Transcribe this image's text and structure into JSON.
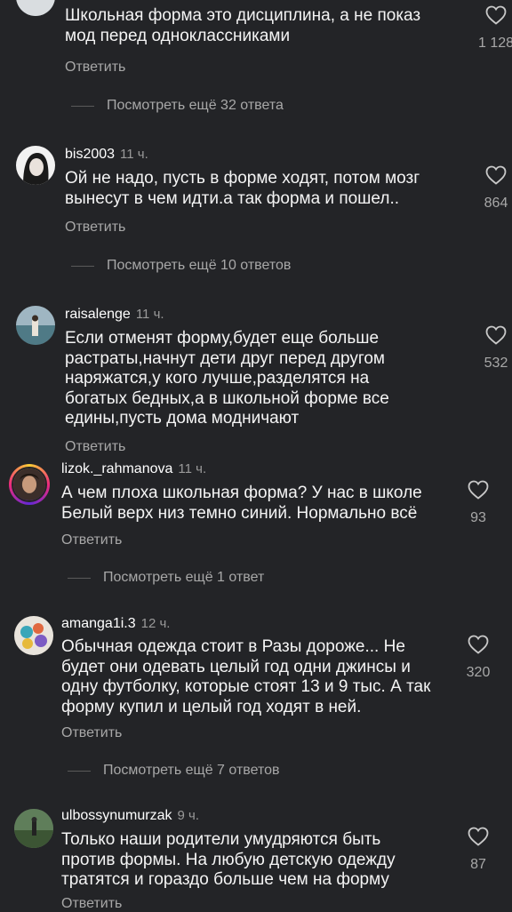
{
  "comments": [
    {
      "username": "",
      "time": "",
      "lines": [
        "Школьная форма это дисциплина, а не показ",
        "мод перед одноклассниками"
      ],
      "reply_label": "Ответить",
      "likes": "1 128",
      "view_more": "Посмотреть ещё 32 ответа"
    },
    {
      "username": "bis2003",
      "time": "11 ч.",
      "lines": [
        "Ой не надо, пусть в форме ходят, потом мозг",
        "вынесут в чем идти.а так форма и пошел.."
      ],
      "reply_label": "Ответить",
      "likes": "864",
      "view_more": "Посмотреть ещё 10 ответов"
    },
    {
      "username": "raisalenge",
      "time": "11 ч.",
      "lines": [
        "Если отменят форму,будет еще больше",
        "растраты,начнут дети друг перед другом",
        "наряжатся,у кого лучше,разделятся на",
        "богатых бедных,а в школьной форме все",
        "едины,пусть дома модничают"
      ],
      "reply_label": "Ответить",
      "likes": "532"
    },
    {
      "username": "lizok._rahmanova",
      "time": "11 ч.",
      "lines": [
        "А чем плоха школьная форма?  У нас в школе",
        "Белый верх низ темно синий. Нормально всё"
      ],
      "reply_label": "Ответить",
      "likes": "93",
      "view_more": "Посмотреть ещё 1 ответ"
    },
    {
      "username": "amanga1i.3",
      "time": "12 ч.",
      "lines": [
        "Обычная одежда стоит в Разы дороже... Не",
        "будет они одевать целый год одни джинсы и",
        "одну футболку, которые стоят 13 и 9 тыс. А так",
        "форму купил и целый год ходят в ней."
      ],
      "reply_label": "Ответить",
      "likes": "320",
      "view_more": "Посмотреть ещё 7 ответов"
    },
    {
      "username": "ulbossynumurzak",
      "time": "9 ч.",
      "lines": [
        "Только наши родители умудряются быть",
        "против формы.  На любую детскую одежду",
        "тратятся и гораздо больше чем на форму"
      ],
      "reply_label": "Ответить",
      "likes": "87"
    }
  ],
  "colors": {
    "background": "#232427",
    "text": "#f4f4f4",
    "secondary": "#a8a8a8"
  },
  "icons": {
    "like": "heart-outline-icon"
  }
}
